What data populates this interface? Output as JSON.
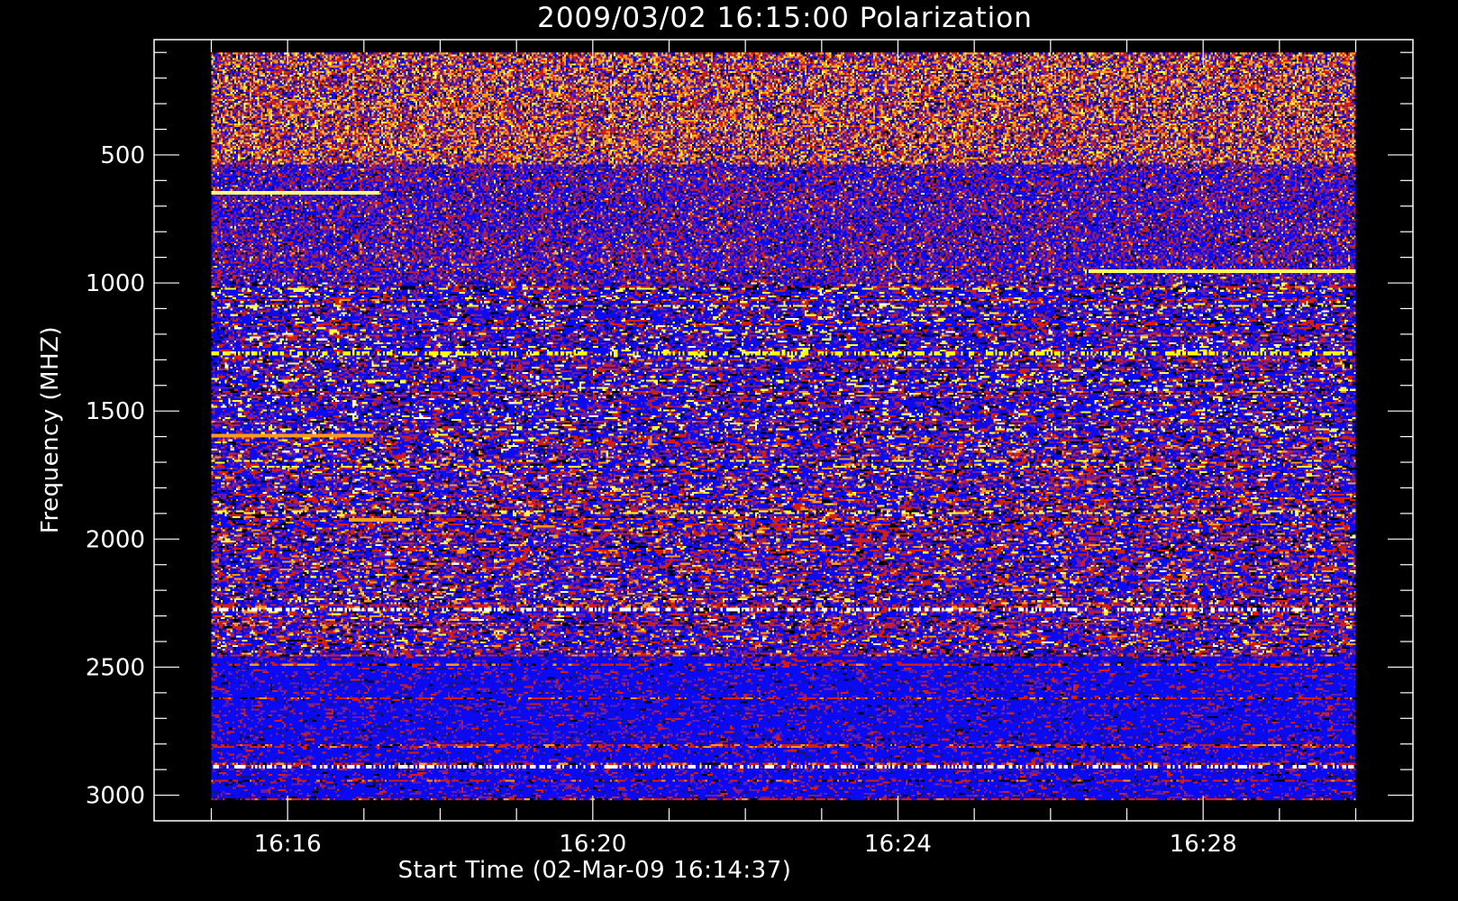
{
  "chart_data": {
    "type": "heatmap",
    "title": "2009/03/02 16:15:00 Polarization",
    "xlabel": "Start Time (02-Mar-09 16:14:37)",
    "ylabel": "Frequency (MHZ)",
    "x_tick_labels": [
      "16:16",
      "16:20",
      "16:24",
      "16:28"
    ],
    "x_tick_minutes": [
      16,
      20,
      24,
      28
    ],
    "x_range_minutes": [
      15.0,
      30.0
    ],
    "xlim_minutes": [
      14.25,
      30.75
    ],
    "y_tick_labels": [
      "500",
      "1000",
      "1500",
      "2000",
      "2500",
      "3000"
    ],
    "y_tick_values": [
      500,
      1000,
      1500,
      2000,
      2500,
      3000
    ],
    "y_range": [
      100,
      3020
    ],
    "ylim": [
      50,
      3100
    ],
    "y_reversed": true,
    "grid": false,
    "colormap": [
      "#000000",
      "#0000ff",
      "#6a20b0",
      "#d42010",
      "#ff9a1a",
      "#ffff40",
      "#ffffff"
    ],
    "frequency_bands": [
      {
        "range": [
          100,
          540
        ],
        "dominant": [
          "#ff9a1a",
          "#d42010",
          "#0000ff",
          "#ffff40"
        ],
        "texture": "speckled noise"
      },
      {
        "range": [
          540,
          1000
        ],
        "dominant": [
          "#0000ff",
          "#6a20b0",
          "#d42010"
        ],
        "texture": "speckled with horizontal lines"
      },
      {
        "range": [
          1000,
          1600
        ],
        "dominant": [
          "#0000ff",
          "#ffff40",
          "#d42010",
          "#ffffff"
        ],
        "texture": "vertical bar structure"
      },
      {
        "range": [
          1600,
          2450
        ],
        "dominant": [
          "#0000ff",
          "#d42010",
          "#ff9a1a",
          "#ffffff"
        ],
        "texture": "vertical bar structure"
      },
      {
        "range": [
          2450,
          3020
        ],
        "dominant": [
          "#0000ff",
          "#d42010"
        ],
        "texture": "mostly blue with sparse red"
      }
    ],
    "bright_features": [
      {
        "freq": 640,
        "t_start": 15.0,
        "t_end": 17.2,
        "color": "#ffff80"
      },
      {
        "freq": 950,
        "t_start": 26.5,
        "t_end": 30.0,
        "color": "#ffff60"
      },
      {
        "freq": 1265,
        "t_start": 15.0,
        "t_end": 30.0,
        "color": "#ffff00"
      },
      {
        "freq": 1590,
        "t_start": 15.0,
        "t_end": 17.1,
        "color": "#ff9a1a"
      },
      {
        "freq": 1915,
        "t_start": 16.8,
        "t_end": 17.6,
        "color": "#ff9a1a"
      },
      {
        "freq": 2270,
        "t_start": 15.0,
        "t_end": 30.0,
        "color": "#ffffff"
      },
      {
        "freq": 2880,
        "t_start": 15.0,
        "t_end": 30.0,
        "color": "#ffffff"
      }
    ]
  }
}
